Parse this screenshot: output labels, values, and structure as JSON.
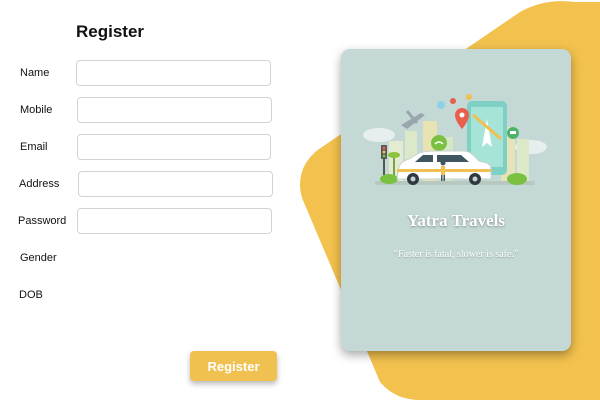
{
  "form": {
    "title": "Register",
    "fields": [
      {
        "label": "Name",
        "value": "",
        "placeholder": ""
      },
      {
        "label": "Mobile",
        "value": "",
        "placeholder": ""
      },
      {
        "label": "Email",
        "value": "",
        "placeholder": ""
      },
      {
        "label": "Address",
        "value": "",
        "placeholder": ""
      },
      {
        "label": "Password",
        "value": "",
        "placeholder": ""
      }
    ],
    "gender_label": "Gender",
    "dob_label": "DOB",
    "submit_label": "Register"
  },
  "card": {
    "brand": "Yatra Travels",
    "tagline": "“Faster is fatal, slower is safe.”",
    "illustration": "city-taxi-navigation-illustration"
  },
  "colors": {
    "accent": "#f0c050",
    "card_background": "#c4d9d5",
    "background_shape": "#f2c14e"
  }
}
